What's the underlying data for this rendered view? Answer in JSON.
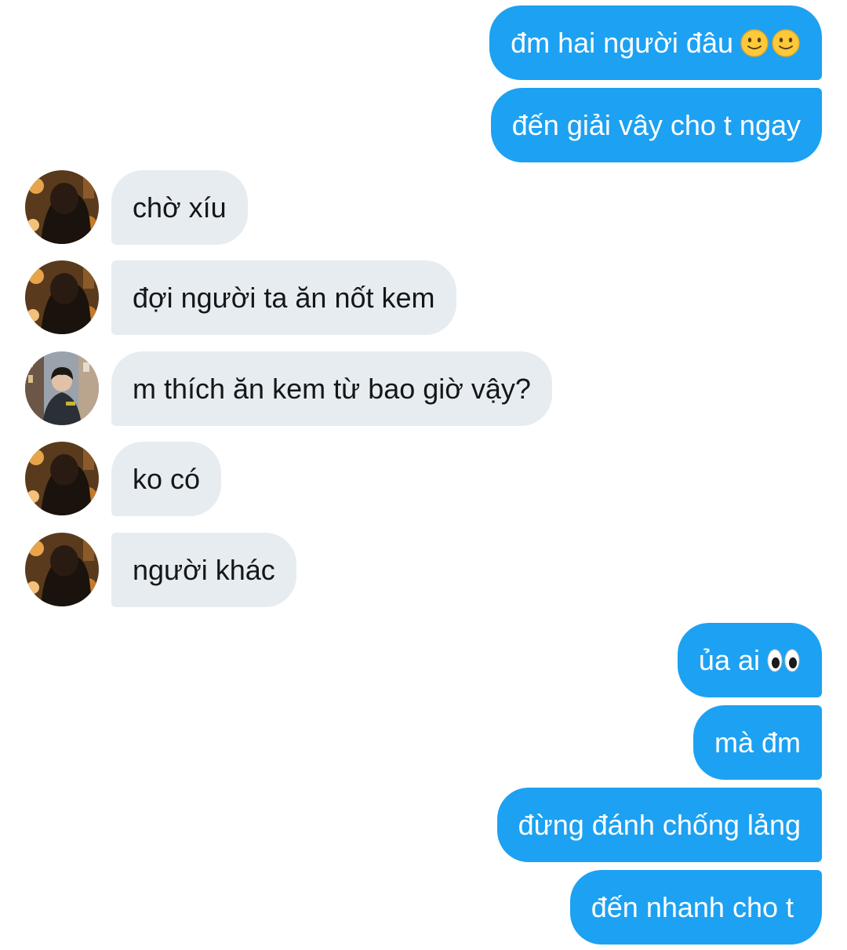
{
  "conversation": {
    "messages": [
      {
        "side": "out",
        "text": "đm hai người đâu",
        "emoji": [
          "slightly-smiling-face-icon",
          "slightly-smiling-face-icon"
        ]
      },
      {
        "side": "out",
        "text": "đến giải vây cho t ngay"
      },
      {
        "side": "in",
        "avatar": "friend-avatar-dark",
        "text": "chờ xíu"
      },
      {
        "side": "in",
        "avatar": "friend-avatar-dark",
        "text": "đợi người ta ăn nốt kem"
      },
      {
        "side": "in",
        "avatar": "friend-avatar-street",
        "text": "m thích ăn kem từ bao giờ vậy?"
      },
      {
        "side": "in",
        "avatar": "friend-avatar-dark",
        "text": "ko có"
      },
      {
        "side": "in",
        "avatar": "friend-avatar-dark",
        "text": "người khác"
      },
      {
        "side": "out",
        "text": "ủa ai",
        "emoji": [
          "eyes-icon"
        ]
      },
      {
        "side": "out",
        "text": "mà đm"
      },
      {
        "side": "out",
        "text": "đừng đánh chống lảng"
      },
      {
        "side": "out",
        "text": "đến nhanh cho t"
      }
    ]
  },
  "colors": {
    "outgoing_bubble": "#1da1f2",
    "outgoing_text": "#ffffff",
    "incoming_bubble": "#e6ecf0",
    "incoming_text": "#14171a",
    "background": "#ffffff"
  }
}
